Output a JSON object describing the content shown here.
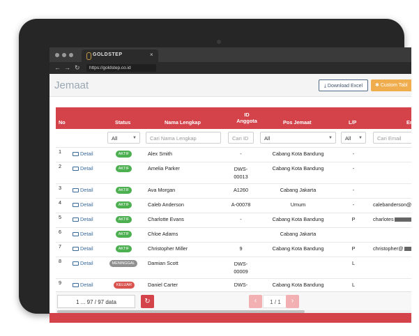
{
  "browser": {
    "tab_title": "GOLDSTEP",
    "tab_close": "×",
    "url": "https://goldstep.co.id",
    "nav": {
      "back": "←",
      "forward": "→",
      "reload": "↻"
    }
  },
  "header": {
    "title": "Jemaat",
    "download_label": "Download Excel",
    "custom_label": "Custom Tabl"
  },
  "table": {
    "columns": {
      "no": "No",
      "status": "Status",
      "nama": "Nama Lengkap",
      "id_line1": "ID",
      "id_line2": "Anggota",
      "pos": "Pos Jemaat",
      "lp": "L/P",
      "email": "Em"
    },
    "filters": {
      "status_value": "All",
      "nama_placeholder": "Cari Nama Lengkap",
      "id_placeholder": "Cari ID",
      "pos_value": "All",
      "lp_value": "All",
      "email_placeholder": "Cari Email"
    },
    "rows": [
      {
        "no": "1",
        "detail": "Detail",
        "status": "AKTIF",
        "nama": "Alex Smith",
        "id": "-",
        "id2": "",
        "pos": "Cabang Kota Bandung",
        "lp": "-",
        "email": ""
      },
      {
        "no": "2",
        "detail": "Detail",
        "status": "AKTIF",
        "nama": "Amelia Parker",
        "id": "DWS-",
        "id2": "00013",
        "pos": "Cabang Kota Bandung",
        "lp": "-",
        "email": ""
      },
      {
        "no": "3",
        "detail": "Detail",
        "status": "AKTIF",
        "nama": "Ava Morgan",
        "id": "A1260",
        "id2": "",
        "pos": "Cabang Jakarta",
        "lp": "-",
        "email": ""
      },
      {
        "no": "4",
        "detail": "Detail",
        "status": "AKTIF",
        "nama": "Caleb Anderson",
        "id": "A-00078",
        "id2": "",
        "pos": "Umum",
        "lp": "-",
        "email": "calebanderson@"
      },
      {
        "no": "5",
        "detail": "Detail",
        "status": "AKTIF",
        "nama": "Charlotte Evans",
        "id": "-",
        "id2": "",
        "pos": "Cabang Kota Bandung",
        "lp": "P",
        "email": "charlotes"
      },
      {
        "no": "6",
        "detail": "Detail",
        "status": "AKTIF",
        "nama": "Chloe Adams",
        "id": "",
        "id2": "",
        "pos": "Cabang Jakarta",
        "lp": "",
        "email": ""
      },
      {
        "no": "7",
        "detail": "Detail",
        "status": "AKTIF",
        "nama": "Christopher Miller",
        "id": "9",
        "id2": "",
        "pos": "Cabang Kota Bandung",
        "lp": "P",
        "email": "christopher@"
      },
      {
        "no": "8",
        "detail": "Detail",
        "status": "MENINGGAL",
        "nama": "Damian Scott",
        "id": "DWS-",
        "id2": "00009",
        "pos": "",
        "lp": "L",
        "email": ""
      },
      {
        "no": "9",
        "detail": "Detail",
        "status": "KELUAR",
        "nama": "Daniel Carter",
        "id": "DWS-",
        "id2": "",
        "pos": "Cabang Kota Bandung",
        "lp": "L",
        "email": ""
      }
    ]
  },
  "footer": {
    "count": "1 ... 97 / 97 data",
    "page_info": "1 / 1",
    "prev": "‹",
    "next": "›",
    "refresh_icon": "↻"
  }
}
